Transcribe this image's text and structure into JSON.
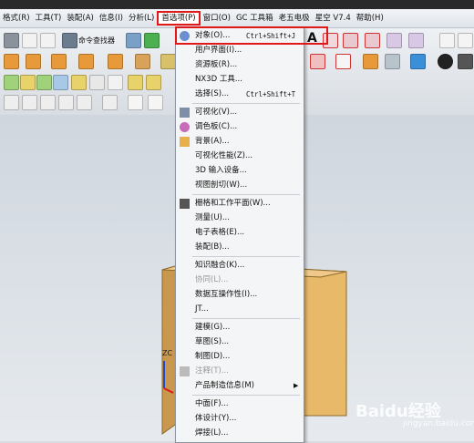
{
  "menubar": {
    "items": [
      {
        "label": "格式(R)"
      },
      {
        "label": "工具(T)"
      },
      {
        "label": "装配(A)"
      },
      {
        "label": "信息(I)"
      },
      {
        "label": "分析(L)"
      },
      {
        "label": "首选项(P)"
      },
      {
        "label": "窗口(O)"
      },
      {
        "label": "GC 工具箱"
      },
      {
        "label": "老五电极"
      },
      {
        "label": "星空 V7.4"
      },
      {
        "label": "帮助(H)"
      }
    ],
    "active_index": 5
  },
  "toolbar": {
    "command_finder_label": "命令查找器",
    "letter_a": "A"
  },
  "dropdown": {
    "items": [
      {
        "label": "对象(O)...",
        "shortcut": "Ctrl+Shift+J",
        "icon": "object-icon"
      },
      {
        "label": "用户界面(I)..."
      },
      {
        "label": "资源板(R)..."
      },
      {
        "label": "NX3D 工具..."
      },
      {
        "label": "选择(S)...",
        "shortcut": "Ctrl+Shift+T"
      },
      {
        "label": "可视化(V)...",
        "icon": "visualization-icon"
      },
      {
        "label": "调色板(C)...",
        "icon": "palette-icon"
      },
      {
        "label": "背景(A)...",
        "icon": "background-icon"
      },
      {
        "label": "可视化性能(Z)..."
      },
      {
        "label": "3D 输入设备..."
      },
      {
        "label": "视图剖切(W)..."
      },
      {
        "label": "栅格和工作平面(W)...",
        "icon": "grid-icon"
      },
      {
        "label": "测量(U)..."
      },
      {
        "label": "电子表格(E)..."
      },
      {
        "label": "装配(B)..."
      },
      {
        "label": "知识融合(K)..."
      },
      {
        "label": "协同(L)...",
        "disabled": true
      },
      {
        "label": "数据互操作性(I)..."
      },
      {
        "label": "JT..."
      },
      {
        "label": "建模(G)..."
      },
      {
        "label": "草图(S)..."
      },
      {
        "label": "制图(D)..."
      },
      {
        "label": "注释(T)...",
        "disabled": true,
        "icon": "annotation-icon"
      },
      {
        "label": "产品制造信息(M)",
        "submenu": true
      },
      {
        "label": "中面(F)..."
      },
      {
        "label": "体设计(Y)..."
      },
      {
        "label": "焊接(L)..."
      }
    ]
  },
  "viewport": {
    "axis_label": "ZC"
  },
  "watermark": {
    "brand": "Baidu经验",
    "sub": "jingyan.baidu.com"
  },
  "colors": {
    "highlight": "#e01818",
    "box_front": "#e9b96a",
    "box_side": "#c9974d"
  }
}
